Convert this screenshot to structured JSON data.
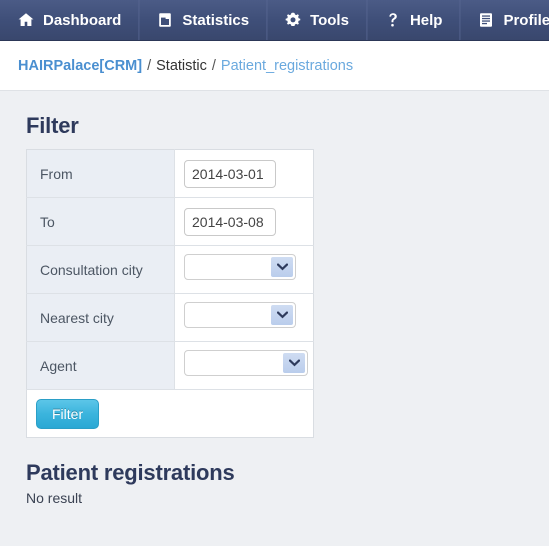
{
  "navbar": {
    "items": [
      {
        "label": "Dashboard",
        "icon": "home-icon"
      },
      {
        "label": "Statistics",
        "icon": "chart-document-icon"
      },
      {
        "label": "Tools",
        "icon": "gear-icon"
      },
      {
        "label": "Help",
        "icon": "question-mark-icon"
      },
      {
        "label": "Profile",
        "icon": "document-list-icon"
      }
    ],
    "background_color": "#3f4f79",
    "text_color": "#ffffff"
  },
  "breadcrumb": {
    "brand": "HAIRPalace[CRM]",
    "separator": "/",
    "middle": "Statistic",
    "current": "Patient_registrations",
    "brand_color": "#4a8fd0",
    "link_color": "#6aa9de"
  },
  "filter": {
    "title": "Filter",
    "rows": [
      {
        "label": "From",
        "type": "text",
        "value": "2014-03-01",
        "placeholder": ""
      },
      {
        "label": "To",
        "type": "text",
        "value": "2014-03-08",
        "placeholder": ""
      },
      {
        "label": "Consultation city",
        "type": "select",
        "value": "",
        "options": [
          ""
        ]
      },
      {
        "label": "Nearest city",
        "type": "select",
        "value": "",
        "options": [
          ""
        ]
      },
      {
        "label": "Agent",
        "type": "select",
        "value": "",
        "options": [
          ""
        ]
      }
    ],
    "submit_label": "Filter",
    "submit_color": "#3bb4dd"
  },
  "results": {
    "title": "Patient registrations",
    "empty_message": "No result"
  }
}
